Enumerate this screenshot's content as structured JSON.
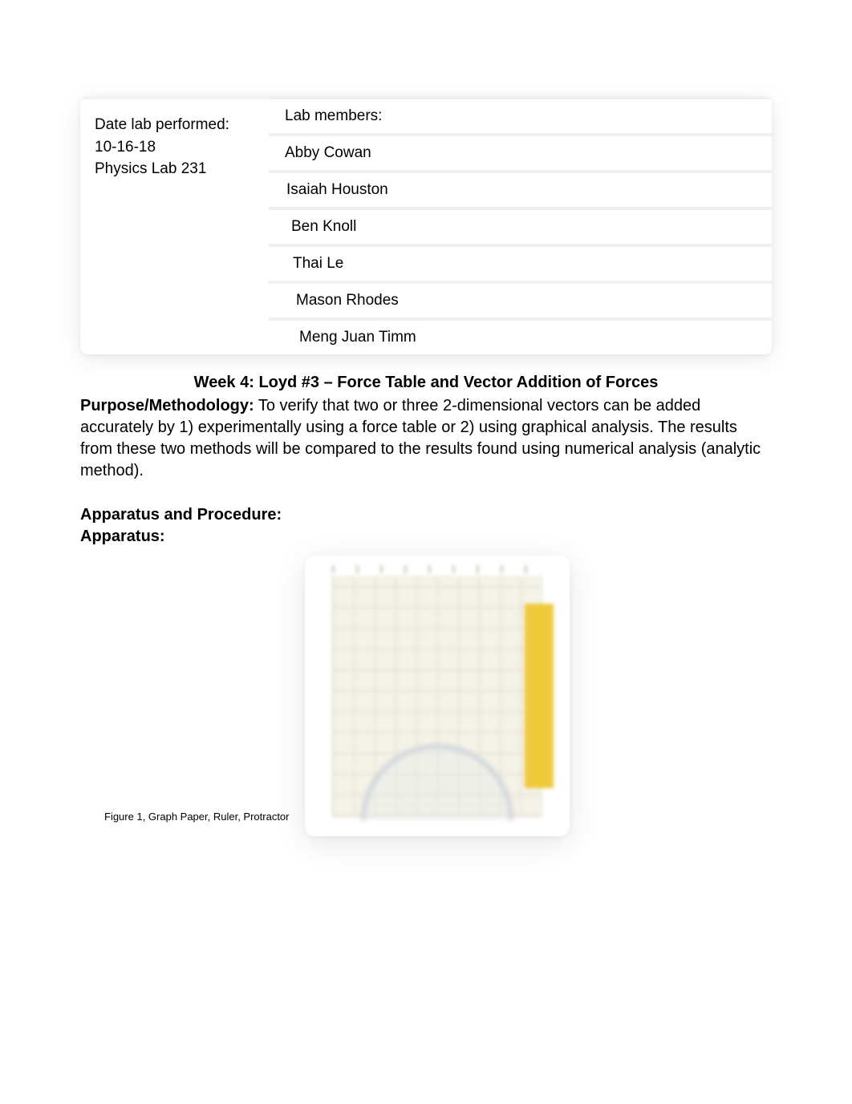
{
  "header": {
    "left": {
      "line1": "Date lab performed:",
      "line2": "10-16-18",
      "line3": "Physics Lab 231"
    },
    "right_label": "Lab members:",
    "members": [
      "Abby Cowan",
      "Isaiah Houston",
      "Ben Knoll",
      "Thai Le",
      "Mason Rhodes",
      "Meng Juan Timm"
    ]
  },
  "title": "Week 4:  Loyd #3 – Force Table and Vector Addition of Forces",
  "purpose": {
    "label": "Purpose/Methodology:",
    "text": "To verify that two or three 2-dimensional vectors can be added accurately by 1) experimentally using a force table or 2) using graphical analysis.  The results from these two methods will be compared to the results found using numerical analysis (analytic method)."
  },
  "apparatus_section": {
    "line1": "Apparatus and Procedure:",
    "line2": "Apparatus:"
  },
  "figure_caption": "Figure 1, Graph Paper, Ruler, Protractor"
}
